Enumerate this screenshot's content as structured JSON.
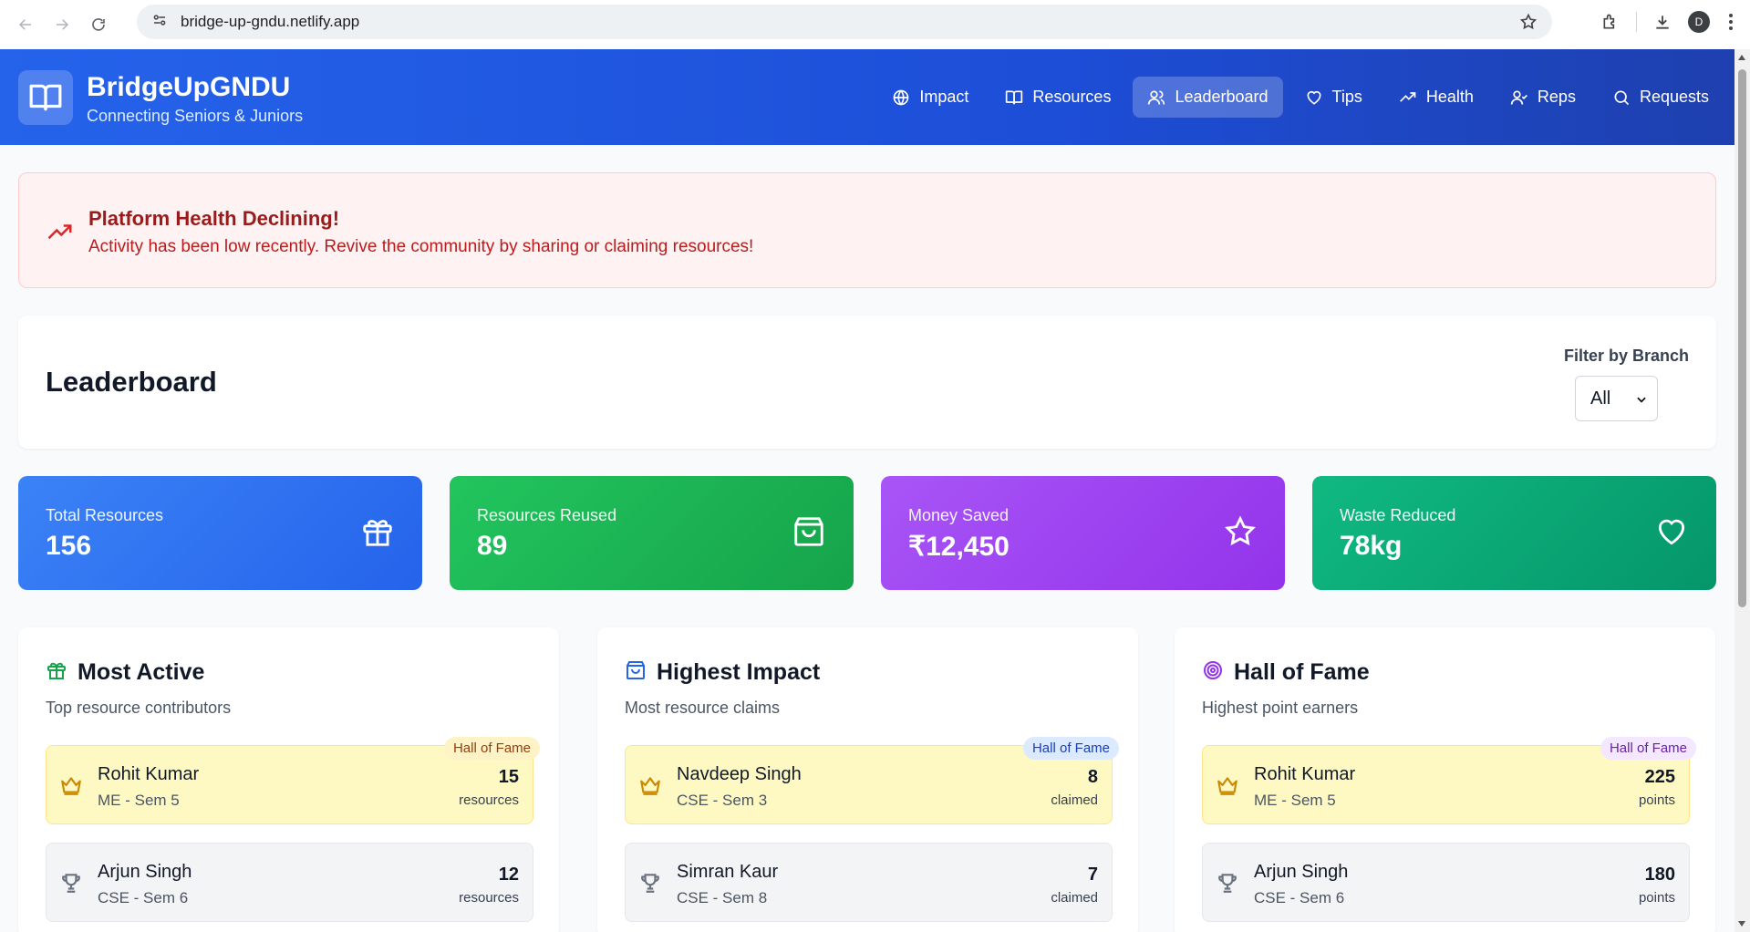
{
  "browser": {
    "url": "bridge-up-gndu.netlify.app",
    "avatar_letter": "D"
  },
  "header": {
    "title": "BridgeUpGNDU",
    "subtitle": "Connecting Seniors & Juniors",
    "nav": [
      {
        "label": "Impact",
        "icon": "globe-icon"
      },
      {
        "label": "Resources",
        "icon": "book-icon"
      },
      {
        "label": "Leaderboard",
        "icon": "users-icon",
        "active": true
      },
      {
        "label": "Tips",
        "icon": "heart-icon"
      },
      {
        "label": "Health",
        "icon": "trending-up-icon"
      },
      {
        "label": "Reps",
        "icon": "user-check-icon"
      },
      {
        "label": "Requests",
        "icon": "search-icon"
      }
    ]
  },
  "alert": {
    "title": "Platform Health Declining!",
    "message": "Activity has been low recently. Revive the community by sharing or claiming resources!"
  },
  "leaderboard": {
    "title": "Leaderboard",
    "filter_label": "Filter by Branch",
    "filter_value": "All"
  },
  "stats": [
    {
      "label": "Total Resources",
      "value": "156",
      "icon": "gift-icon"
    },
    {
      "label": "Resources Reused",
      "value": "89",
      "icon": "shopping-bag-icon"
    },
    {
      "label": "Money Saved",
      "value": "₹12,450",
      "icon": "star-icon"
    },
    {
      "label": "Waste Reduced",
      "value": "78kg",
      "icon": "heart-icon"
    }
  ],
  "panels": [
    {
      "title": "Most Active",
      "subtitle": "Top resource contributors",
      "icon": "gift-icon",
      "rows": [
        {
          "name": "Rohit Kumar",
          "meta": "ME - Sem 5",
          "num": "15",
          "unit": "resources",
          "badge": "Hall of Fame"
        },
        {
          "name": "Arjun Singh",
          "meta": "CSE - Sem 6",
          "num": "12",
          "unit": "resources"
        }
      ]
    },
    {
      "title": "Highest Impact",
      "subtitle": "Most resource claims",
      "icon": "shopping-bag-icon",
      "rows": [
        {
          "name": "Navdeep Singh",
          "meta": "CSE - Sem 3",
          "num": "8",
          "unit": "claimed",
          "badge": "Hall of Fame"
        },
        {
          "name": "Simran Kaur",
          "meta": "CSE - Sem 8",
          "num": "7",
          "unit": "claimed"
        }
      ]
    },
    {
      "title": "Hall of Fame",
      "subtitle": "Highest point earners",
      "icon": "target-icon",
      "rows": [
        {
          "name": "Rohit Kumar",
          "meta": "ME - Sem 5",
          "num": "225",
          "unit": "points",
          "badge": "Hall of Fame"
        },
        {
          "name": "Arjun Singh",
          "meta": "CSE - Sem 6",
          "num": "180",
          "unit": "points"
        }
      ]
    }
  ],
  "colors": {
    "header": "#2563eb",
    "alert_text": "#991b1b",
    "total_resources": "#3b82f6",
    "resources_reused": "#22c55e",
    "money_saved": "#a855f7",
    "waste_reduced": "#10b981"
  }
}
